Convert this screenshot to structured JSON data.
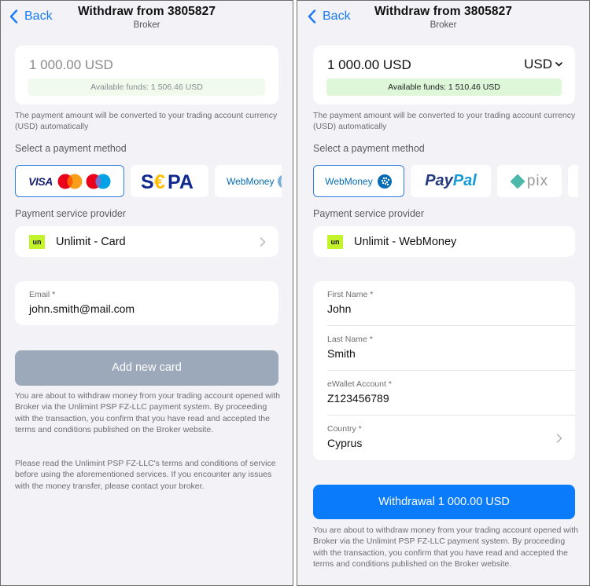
{
  "left": {
    "nav": {
      "back_label": "Back",
      "title": "Withdraw from 3805827",
      "subtitle": "Broker"
    },
    "amount": {
      "value": "1 000.00 USD",
      "available_funds": "Available funds: 1 506.46 USD"
    },
    "conversion_note": "The payment amount will be converted to your trading account currency (USD) automatically",
    "payment_method_label": "Select a payment method",
    "payment_methods": [
      {
        "name": "Visa / Mastercard / Maestro",
        "label": "VISA",
        "selected": true
      },
      {
        "name": "SEPA",
        "label": "SEPA",
        "selected": false
      },
      {
        "name": "WebMoney",
        "label": "WebMoney",
        "selected": false
      }
    ],
    "provider_label": "Payment service provider",
    "provider": {
      "logo_text": "un",
      "name": "Unlimit - Card"
    },
    "email": {
      "label": "Email *",
      "value": "john.smith@mail.com"
    },
    "add_card_button": "Add new card",
    "disclaimer_1": "You are about to withdraw money from your trading account opened with Broker via the Unlimint PSP FZ-LLC payment system. By proceeding with the transaction, you confirm that you have read and accepted the terms and conditions published on the Broker website.",
    "disclaimer_2": "Please read the Unlimint PSP FZ-LLC's terms and conditions of service before using the aforementioned services. If you encounter any issues with the money transfer, please contact your broker."
  },
  "right": {
    "nav": {
      "back_label": "Back",
      "title": "Withdraw from 3805827",
      "subtitle": "Broker"
    },
    "amount": {
      "value": "1 000.00 USD",
      "currency": "USD",
      "available_funds": "Available funds: 1 510.46 USD"
    },
    "conversion_note": "The payment amount will be converted to your trading account currency (USD) automatically",
    "payment_method_label": "Select a payment method",
    "payment_methods": [
      {
        "name": "WebMoney",
        "label": "WebMoney",
        "selected": true
      },
      {
        "name": "PayPal",
        "label_a": "Pay",
        "label_b": "Pal",
        "selected": false
      },
      {
        "name": "Pix",
        "label": "pix",
        "selected": false
      }
    ],
    "provider_label": "Payment service provider",
    "provider": {
      "logo_text": "un",
      "name": "Unlimit - WebMoney"
    },
    "fields": [
      {
        "label": "First Name *",
        "value": "John"
      },
      {
        "label": "Last Name *",
        "value": "Smith"
      },
      {
        "label": "eWallet Account *",
        "value": "Z123456789"
      },
      {
        "label": "Country *",
        "value": "Cyprus"
      }
    ],
    "withdraw_button": "Withdrawal 1 000.00 USD",
    "disclaimer_1": "You are about to withdraw money from your trading account opened with Broker via the Unlimint PSP FZ-LLC payment system. By proceeding with the transaction, you confirm that you have read and accepted the terms and conditions published on the Broker website."
  },
  "colors": {
    "accent": "#0a7cfb",
    "background": "#f2f2f7",
    "funds_bg": "#ddf7d8",
    "provider_logo": "#c3f32a",
    "disabled_button": "#9ca9bb"
  }
}
